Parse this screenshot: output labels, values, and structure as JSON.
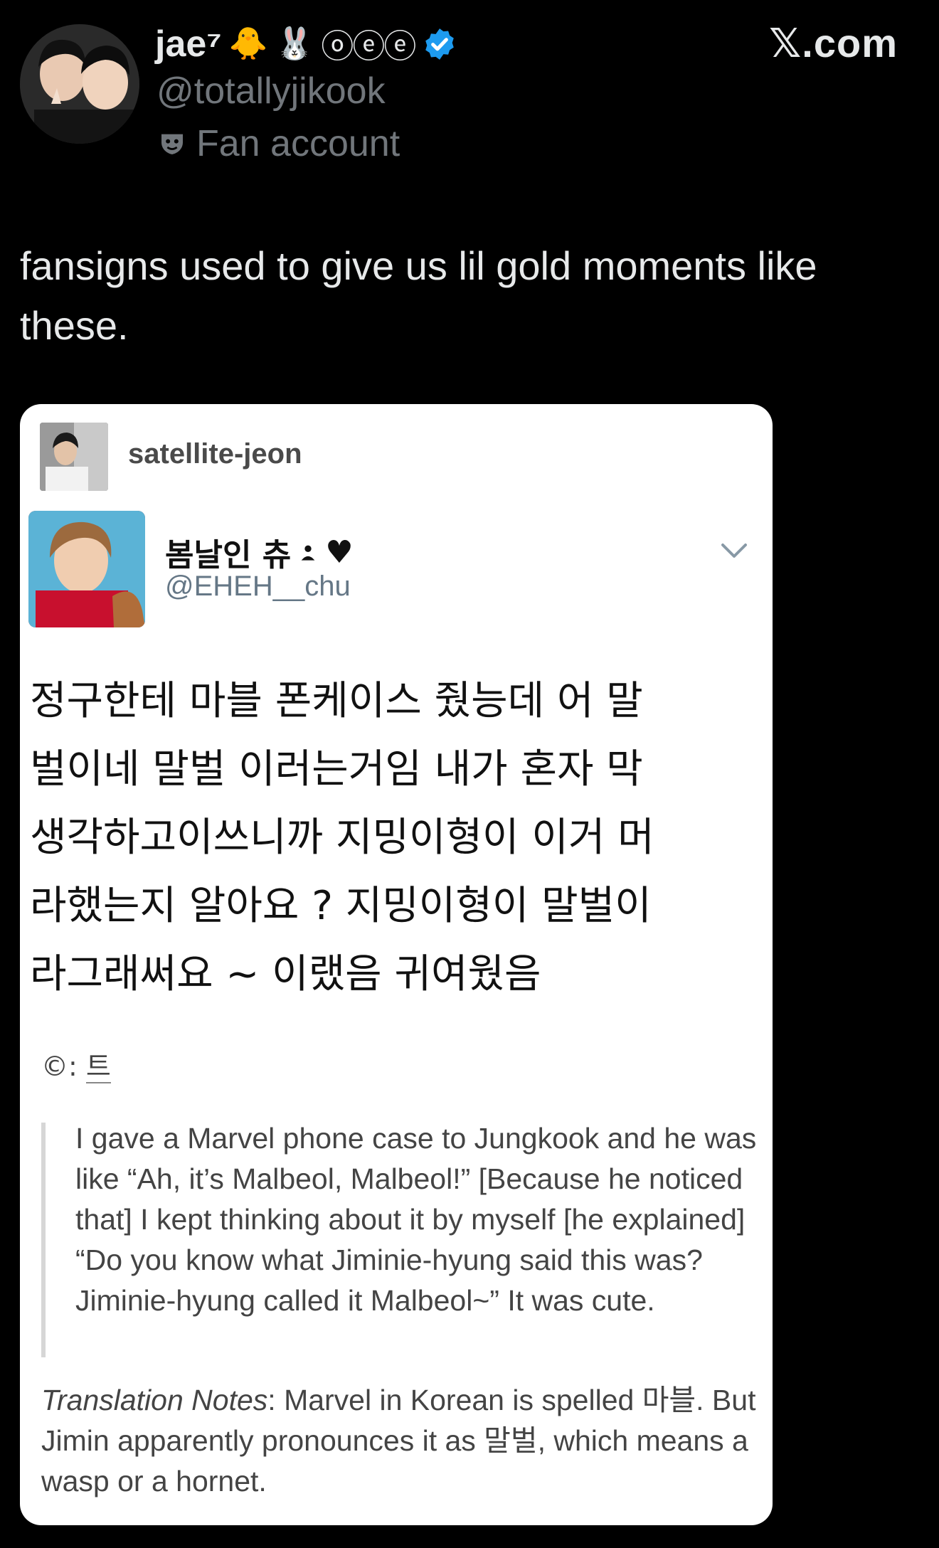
{
  "post": {
    "display_name": "jae⁷",
    "name_emojis": [
      "🐥",
      "🐰"
    ],
    "name_circled_letters": "ⓞⓔⓔ",
    "handle": "@totallyjikook",
    "account_label": "Fan account",
    "site_label": "𝕏.com",
    "text": "fansigns used to give us lil gold moments like these.",
    "icons": [
      "verified-badge-icon",
      "mask-icon"
    ],
    "colors": {
      "background": "#000000",
      "text": "#e7e9ea",
      "muted": "#71767b",
      "verified": "#1d9bf0"
    }
  },
  "card": {
    "reblogger": "satellite-jeon",
    "author_name": "봄날인 츄",
    "author_decor": "♥",
    "author_handle": "@EHEH__chu",
    "korean_lines": [
      "정구한테 마블 폰케이스 줬능데 어 말",
      "벌이네 말벌 이러는거임 내가 혼자 막",
      "생각하고이쓰니까 지밍이형이 이거 머",
      "라했는지 알아요 ? 지밍이형이 말벌이",
      "라그래써요 ~ 이랬음 귀여웠음"
    ],
    "credit_prefix": "©: ",
    "credit_source": "트",
    "translation": "I gave a Marvel phone case to Jungkook and he was like “Ah, it’s Malbeol, Malbeol!” [Because he noticed that] I kept thinking about it by myself [he explained] “Do you know what Jiminie-hyung said this was? Jiminie-hyung called it Malbeol~” It was cute.",
    "notes_label": "Translation Notes",
    "notes_text": ": Marvel in Korean is spelled 마블. But Jimin apparently pronounces it as 말벌, which means a wasp or a hornet."
  }
}
